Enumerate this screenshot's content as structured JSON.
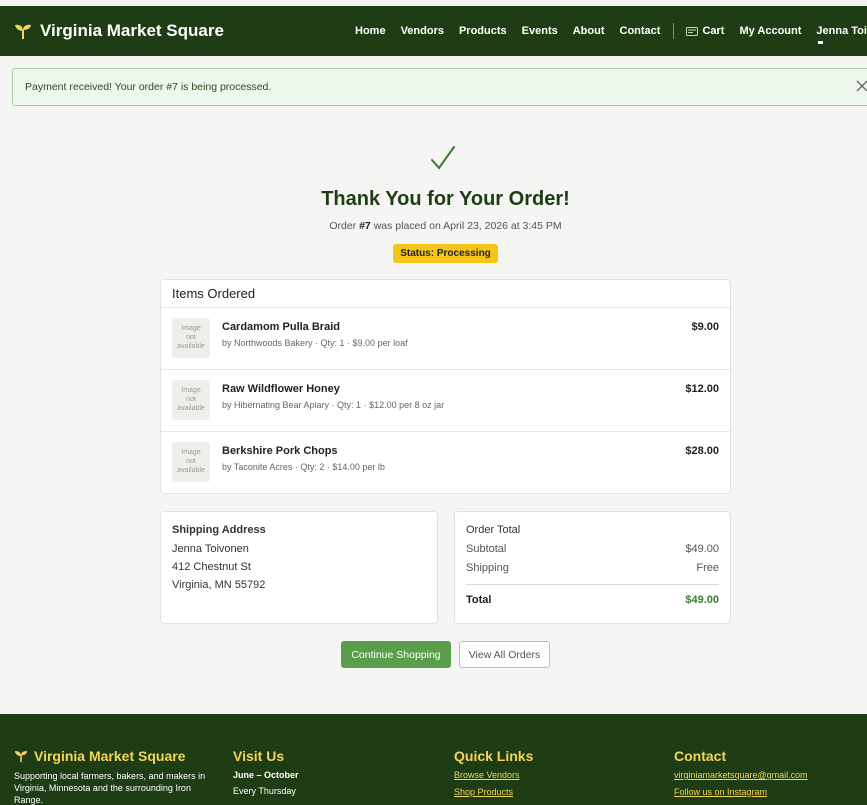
{
  "brand": {
    "name": "Virginia Market Square"
  },
  "nav": {
    "links": [
      "Home",
      "Vendors",
      "Products",
      "Events",
      "About",
      "Contact"
    ],
    "cart": "Cart",
    "account": "My Account",
    "user": "Jenna Toivonen"
  },
  "alert": {
    "message": "Payment received! Your order #7 is being processed."
  },
  "confirmation": {
    "title": "Thank You for Your Order!",
    "order_prefix": "Order ",
    "order_number": "#7",
    "order_suffix": " was placed on April 23, 2026 at 3:45 PM",
    "status": "Status: Processing"
  },
  "items": {
    "heading": "Items Ordered",
    "image_placeholder": [
      "Image",
      "not",
      "available"
    ],
    "rows": [
      {
        "name": "Cardamom Pulla Braid",
        "meta": "by Northwoods Bakery · Qty: 1 · $9.00 per loaf",
        "price": "$9.00"
      },
      {
        "name": "Raw Wildflower Honey",
        "meta": "by Hibernating Bear Apiary · Qty: 1 · $12.00 per 8 oz jar",
        "price": "$12.00"
      },
      {
        "name": "Berkshire Pork Chops",
        "meta": "by Taconite Acres · Qty: 2 · $14.00 per lb",
        "price": "$28.00"
      }
    ]
  },
  "shipping": {
    "heading": "Shipping Address",
    "name": "Jenna Toivonen",
    "street": "412 Chestnut St",
    "city": "Virginia, MN 55792"
  },
  "totals": {
    "heading": "Order Total",
    "subtotal_label": "Subtotal",
    "subtotal": "$49.00",
    "shipping_label": "Shipping",
    "shipping": "Free",
    "total_label": "Total",
    "total": "$49.00"
  },
  "buttons": {
    "continue": "Continue Shopping",
    "orders": "View All Orders"
  },
  "footer": {
    "brand": "Virginia Market Square",
    "about": "Supporting local farmers, bakers, and makers in Virginia, Minnesota and the surrounding Iron Range.",
    "visit_heading": "Visit Us",
    "visit_season": "June – October",
    "visit_day": "Every Thursday",
    "links_heading": "Quick Links",
    "link_vendors": "Browse Vendors",
    "link_products": "Shop Products",
    "contact_heading": "Contact",
    "email": "virginiamarketsquare@gmail.com",
    "instagram": "Follow us on Instagram"
  },
  "colors": {
    "nav_bg": "#1f3d14",
    "accent_green": "#5a9e4b",
    "status_yellow": "#f5c518",
    "footer_heading": "#f2d45c"
  }
}
